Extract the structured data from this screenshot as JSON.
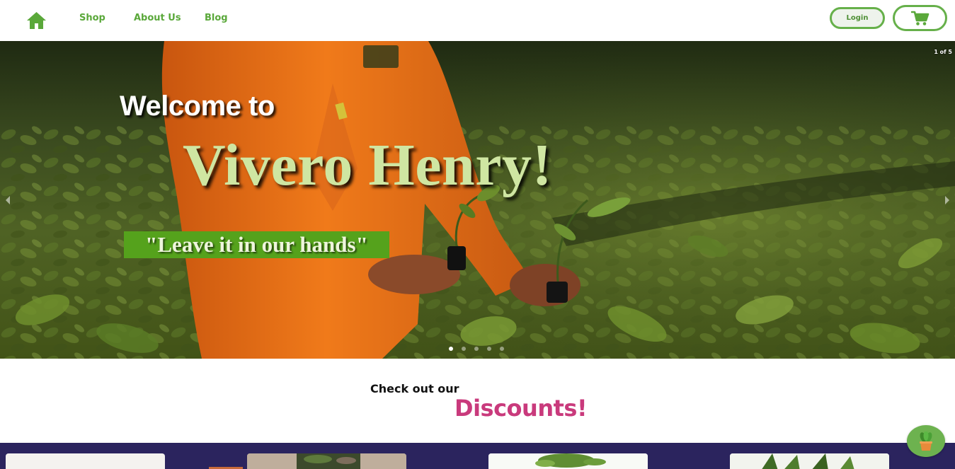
{
  "nav": {
    "home_icon": "home-icon",
    "links": [
      "Shop",
      "About Us",
      "Blog"
    ],
    "login_label": "Login",
    "cart_icon": "shopping-cart-icon",
    "accent_color": "#5aa83a"
  },
  "hero": {
    "slide_counter": "1 of 5",
    "welcome": "Welcome to",
    "brand": "Vivero Henry!",
    "tagline": "\"Leave it in our hands\"",
    "active_slide": 1,
    "total_slides": 5,
    "prev_icon": "chevron-left-icon",
    "next_icon": "chevron-right-icon",
    "brand_color": "#cfe6a2",
    "tagline_bg": "#55a21c"
  },
  "discounts": {
    "intro": "Check out our",
    "heading": "Discounts!",
    "heading_color": "#c93a7c"
  },
  "products": {
    "band_color": "#2b245e",
    "card_count": 4
  },
  "floating_button": {
    "icon": "potted-plant-icon",
    "color": "#6db24f"
  }
}
